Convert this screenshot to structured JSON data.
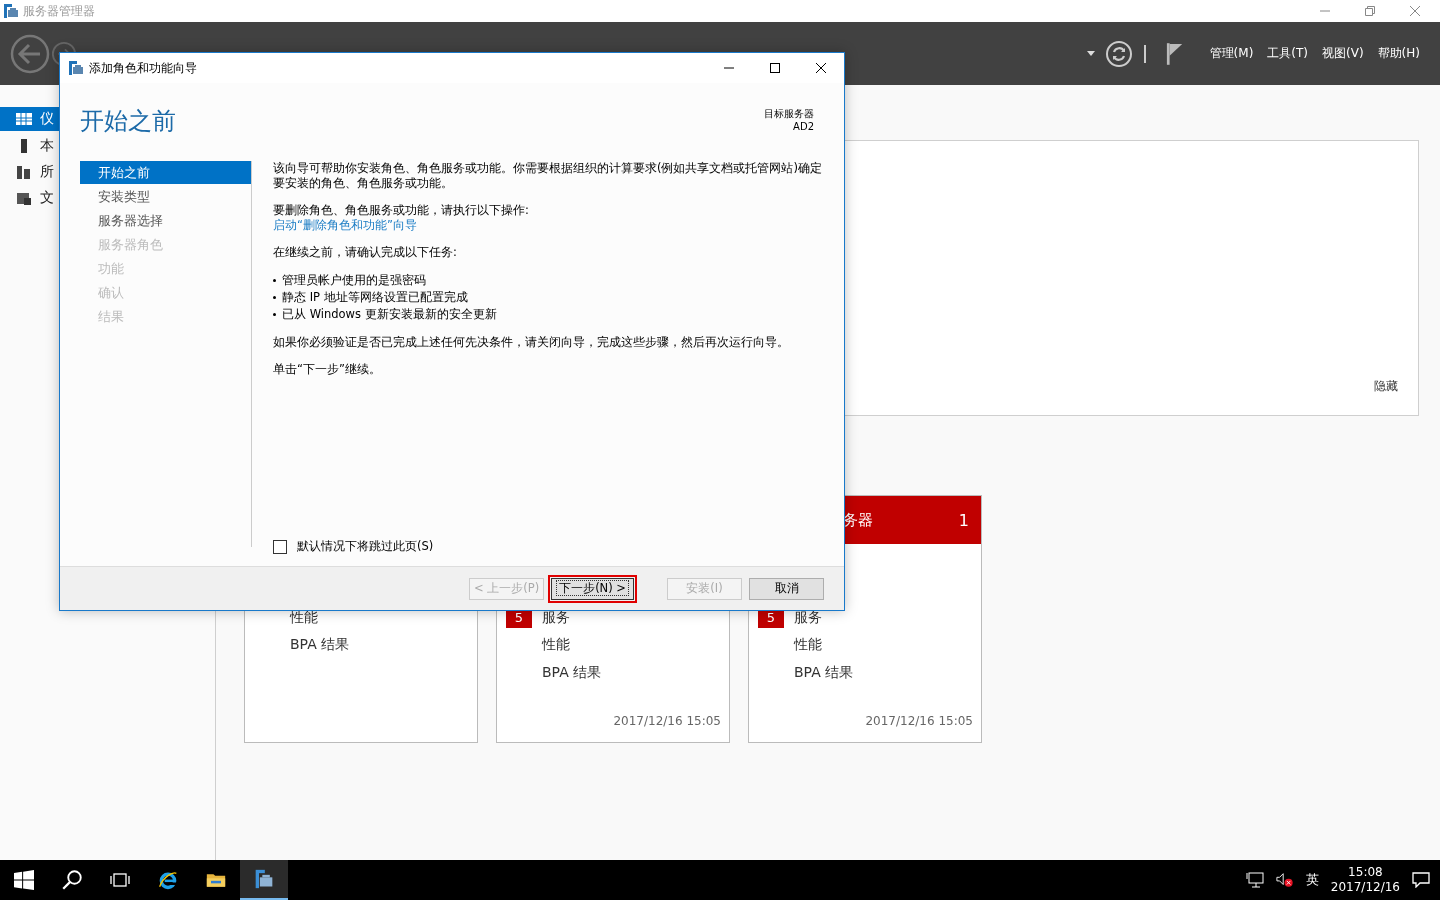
{
  "app": {
    "title": "服务器管理器"
  },
  "header": {
    "menus": [
      "管理(M)",
      "工具(T)",
      "视图(V)",
      "帮助(H)"
    ]
  },
  "nav": [
    {
      "label": "仪",
      "kind": "dashboard",
      "selected": true
    },
    {
      "label": "本",
      "kind": "server",
      "selected": false
    },
    {
      "label": "所",
      "kind": "servers",
      "selected": false
    },
    {
      "label": "文",
      "kind": "files",
      "selected": false
    }
  ],
  "welcome": {
    "link": "隐藏"
  },
  "tiles": [
    {
      "rows": [
        {
          "label": "性能"
        },
        {
          "label": "BPA 结果"
        }
      ]
    },
    {
      "rows": [
        {
          "label": "服务",
          "badge": "5"
        },
        {
          "label": "性能"
        },
        {
          "label": "BPA 结果"
        }
      ],
      "timestamp": "2017/12/16 15:05"
    },
    {
      "header": {
        "title": "务器",
        "count": "1"
      },
      "rows": [
        {
          "label": "服务",
          "badge": "5"
        },
        {
          "label": "性能"
        },
        {
          "label": "BPA 结果"
        }
      ],
      "timestamp": "2017/12/16 15:05"
    }
  ],
  "dialog": {
    "title": "添加角色和功能向导",
    "heading": "开始之前",
    "target_label": "目标服务器",
    "target_value": "AD2",
    "steps": [
      {
        "label": "开始之前",
        "selected": true,
        "disabled": false
      },
      {
        "label": "安装类型",
        "selected": false,
        "disabled": false
      },
      {
        "label": "服务器选择",
        "selected": false,
        "disabled": false
      },
      {
        "label": "服务器角色",
        "selected": false,
        "disabled": true
      },
      {
        "label": "功能",
        "selected": false,
        "disabled": true
      },
      {
        "label": "确认",
        "selected": false,
        "disabled": true
      },
      {
        "label": "结果",
        "selected": false,
        "disabled": true
      }
    ],
    "content": [
      {
        "kind": "text",
        "text": "该向导可帮助你安装角色、角色服务或功能。你需要根据组织的计算要求(例如共享文档或托管网站)确定要安装的角色、角色服务或功能。"
      },
      {
        "kind": "text",
        "text": "要删除角色、角色服务或功能，请执行以下操作:"
      },
      {
        "kind": "link",
        "text": "启动“删除角色和功能”向导"
      },
      {
        "kind": "text",
        "text": "在继续之前，请确认完成以下任务:"
      },
      {
        "kind": "bullet",
        "text": "管理员帐户使用的是强密码"
      },
      {
        "kind": "bullet",
        "text": "静态 IP 地址等网络设置已配置完成"
      },
      {
        "kind": "bullet",
        "text": "已从 Windows 更新安装最新的安全更新"
      },
      {
        "kind": "text",
        "text": "如果你必须验证是否已完成上述任何先决条件，请关闭向导，完成这些步骤，然后再次运行向导。"
      },
      {
        "kind": "text",
        "text": "单击“下一步”继续。"
      }
    ],
    "skip_checkbox": {
      "label": "默认情况下将跳过此页(S)",
      "checked": false
    },
    "buttons": [
      {
        "label": "< 上一步(P)",
        "disabled": true,
        "focused": false
      },
      {
        "label": "下一步(N) >",
        "disabled": false,
        "focused": true
      },
      {
        "label": "安装(I)",
        "disabled": true,
        "focused": false
      },
      {
        "label": "取消",
        "disabled": false,
        "focused": false
      }
    ]
  },
  "taskbar": {
    "apps": [
      {
        "kind": "start",
        "selected": false
      },
      {
        "kind": "search",
        "selected": false
      },
      {
        "kind": "taskview",
        "selected": false
      },
      {
        "kind": "browser",
        "selected": false
      },
      {
        "kind": "folder",
        "selected": false
      },
      {
        "kind": "servermanager",
        "selected": true
      }
    ],
    "ime": "英",
    "time": "15:08",
    "date": "2017/12/16"
  }
}
